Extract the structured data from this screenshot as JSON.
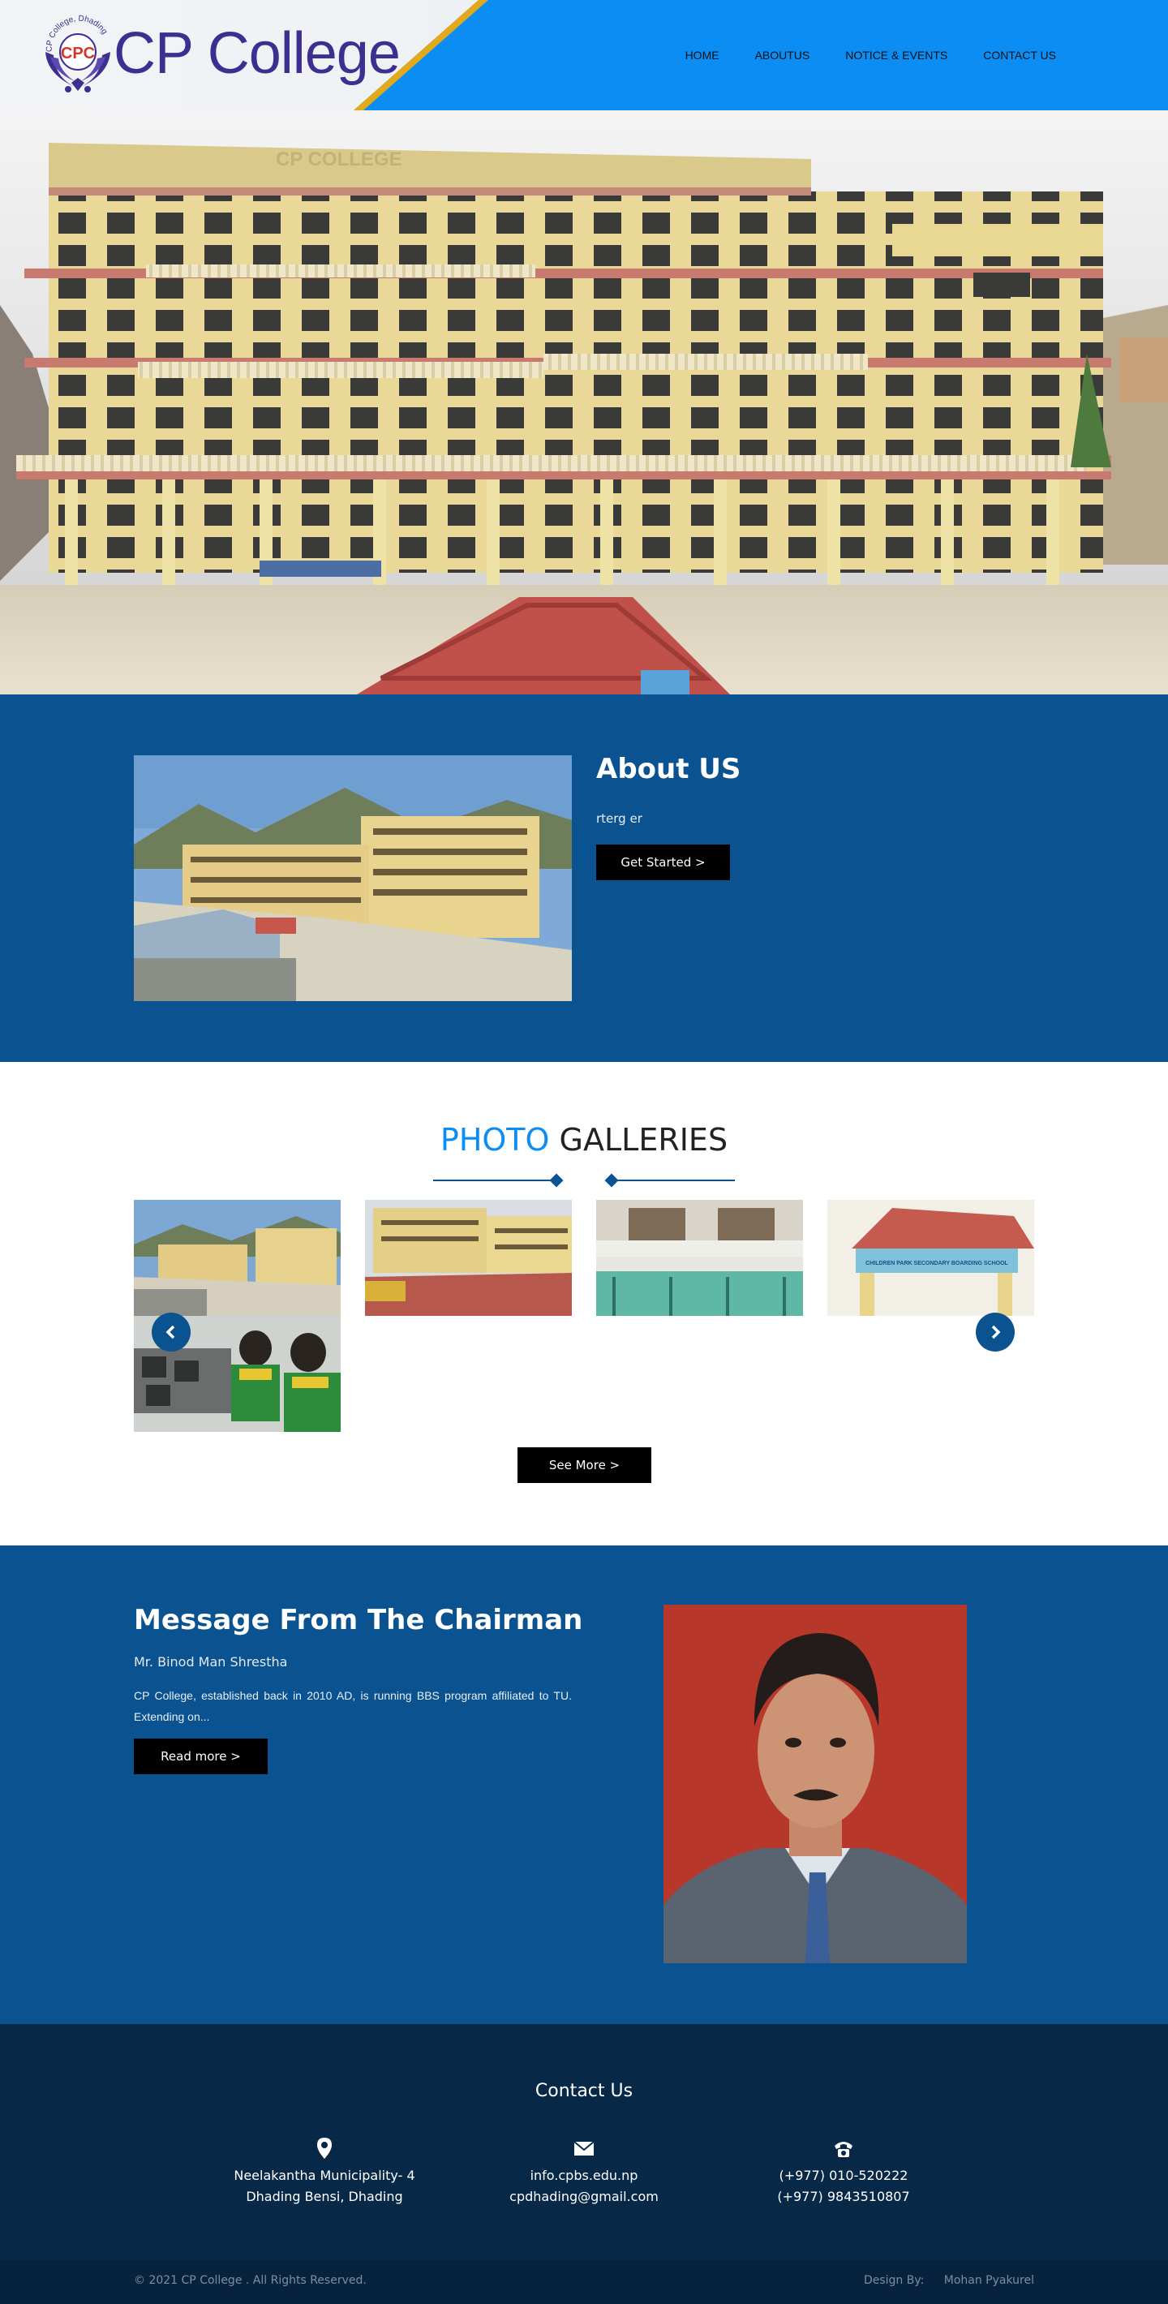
{
  "header": {
    "logo_text": "CP College",
    "logo_emblem_text": "CPC",
    "logo_arc_text": "CP College, Dhading",
    "colors": {
      "bar": "#0b8df4",
      "stripe": "#e2a91a",
      "logo": "#3d2f8f"
    }
  },
  "nav": {
    "items": [
      {
        "label": "HOME"
      },
      {
        "label": "ABOUTUS"
      },
      {
        "label": "NOTICE & EVENTS"
      },
      {
        "label": "CONTACT US"
      }
    ]
  },
  "hero": {
    "sign_text": "CP COLLEGE"
  },
  "about": {
    "title": "About US",
    "text": "rterg er",
    "button_label": "Get Started >"
  },
  "gallery": {
    "title_accent": "PHOTO",
    "title_rest": "GALLERIES",
    "button_label": "See More >",
    "prev_icon": "chevron-left-icon",
    "next_icon": "chevron-right-icon",
    "sign_text": "CHILDREN PARK SECONDARY BOARDING SCHOOL"
  },
  "chairman": {
    "title": "Message From The Chairman",
    "name": "Mr. Binod Man Shrestha",
    "text": "CP College, established back in 2010 AD, is running BBS program affiliated to TU. Extending on...",
    "button_label": "Read more >"
  },
  "contact": {
    "title": "Contact Us",
    "address_line1": "Neelakantha Municipality- 4",
    "address_line2": "Dhading Bensi, Dhading",
    "email_line1": "info.cpbs.edu.np",
    "email_line2": "cpdhading@gmail.com",
    "phone_line1": "(+977) 010-520222",
    "phone_line2": "(+977) 9843510807",
    "icons": [
      "map-marker-icon",
      "envelope-icon",
      "phone-icon"
    ]
  },
  "footer": {
    "copyright": "© 2021 CP College . All Rights Reserved.",
    "design_label": "Design By:",
    "designer": "Mohan Pyakurel"
  }
}
